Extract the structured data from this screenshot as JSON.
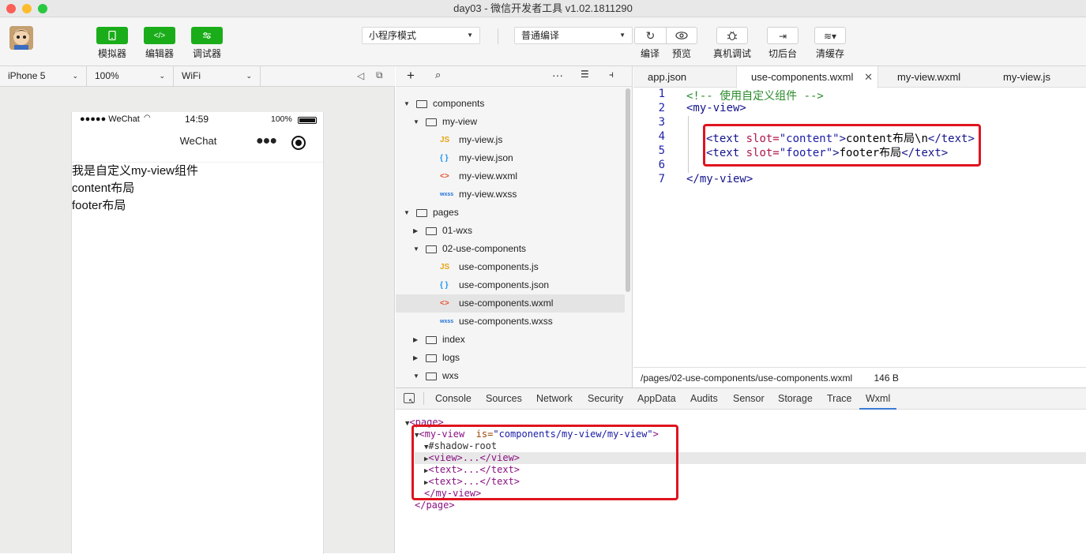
{
  "window": {
    "title": "day03 - 微信开发者工具 v1.02.1811290"
  },
  "toolbar": {
    "simulator": "模拟器",
    "editor": "编辑器",
    "debugger": "调试器",
    "mode": "小程序模式",
    "compile_mode": "普通编译",
    "compile": "编译",
    "preview": "预览",
    "real_debug": "真机调试",
    "background": "切后台",
    "clear_cache": "清缓存"
  },
  "device": {
    "model": "iPhone 5",
    "zoom": "100%",
    "network": "WiFi"
  },
  "phone": {
    "carrier": "●●●●● WeChat",
    "time": "14:59",
    "battery": "100%",
    "nav_title": "WeChat",
    "lines": [
      "我是自定义my-view组件",
      "content布局",
      "footer布局"
    ]
  },
  "explorer": {
    "tree": [
      {
        "label": "components",
        "type": "folder",
        "open": true,
        "depth": 0
      },
      {
        "label": "my-view",
        "type": "folder",
        "open": true,
        "depth": 1
      },
      {
        "label": "my-view.js",
        "type": "js",
        "depth": 2
      },
      {
        "label": "my-view.json",
        "type": "json",
        "depth": 2
      },
      {
        "label": "my-view.wxml",
        "type": "wxml",
        "depth": 2
      },
      {
        "label": "my-view.wxss",
        "type": "wxss",
        "depth": 2
      },
      {
        "label": "pages",
        "type": "folder",
        "open": true,
        "depth": 0
      },
      {
        "label": "01-wxs",
        "type": "folder",
        "open": false,
        "depth": 1
      },
      {
        "label": "02-use-components",
        "type": "folder",
        "open": true,
        "depth": 1
      },
      {
        "label": "use-components.js",
        "type": "js",
        "depth": 2
      },
      {
        "label": "use-components.json",
        "type": "json",
        "depth": 2
      },
      {
        "label": "use-components.wxml",
        "type": "wxml",
        "depth": 2,
        "selected": true
      },
      {
        "label": "use-components.wxss",
        "type": "wxss",
        "depth": 2
      },
      {
        "label": "index",
        "type": "folder",
        "open": false,
        "depth": 1
      },
      {
        "label": "logs",
        "type": "folder",
        "open": false,
        "depth": 1
      },
      {
        "label": "wxs",
        "type": "folder",
        "open": true,
        "depth": 1
      }
    ]
  },
  "editor": {
    "tabs": [
      "app.json",
      "use-components.wxml",
      "my-view.wxml",
      "my-view.js"
    ],
    "active_tab": "use-components.wxml",
    "line_numbers": [
      "1",
      "2",
      "3",
      "4",
      "5",
      "6",
      "7"
    ],
    "code": {
      "l1": "<!-- 使用自定义组件 -->",
      "l2_tag": "<my-view>",
      "l4_open": "<text",
      "l4_attr": " slot=",
      "l4_val": "\"content\"",
      "l4_gt": ">",
      "l4_text": "content布局\\n",
      "l4_close": "</text>",
      "l5_open": "<text",
      "l5_attr": " slot=",
      "l5_val": "\"footer\"",
      "l5_gt": ">",
      "l5_text": "footer布局",
      "l5_close": "</text>",
      "l7_tag": "</my-view>"
    },
    "file_path": "/pages/02-use-components/use-components.wxml",
    "file_size": "146 B"
  },
  "devtools": {
    "tabs": [
      "Console",
      "Sources",
      "Network",
      "Security",
      "AppData",
      "Audits",
      "Sensor",
      "Storage",
      "Trace",
      "Wxml"
    ],
    "active_tab": "Wxml",
    "xml": {
      "page_open": "<page>",
      "myview_tag": "<my-view",
      "myview_attr": "is=",
      "myview_val": "\"components/my-view/my-view\"",
      "myview_gt": ">",
      "shadow": "#shadow-root",
      "view_node": "<view>...</view>",
      "text_node_1": "<text>...</text>",
      "text_node_2": "<text>...</text>",
      "myview_close": "</my-view>",
      "page_close": "</page>"
    }
  },
  "colors": {
    "accent_green": "#1aad19",
    "highlight_red": "#e0141e"
  }
}
